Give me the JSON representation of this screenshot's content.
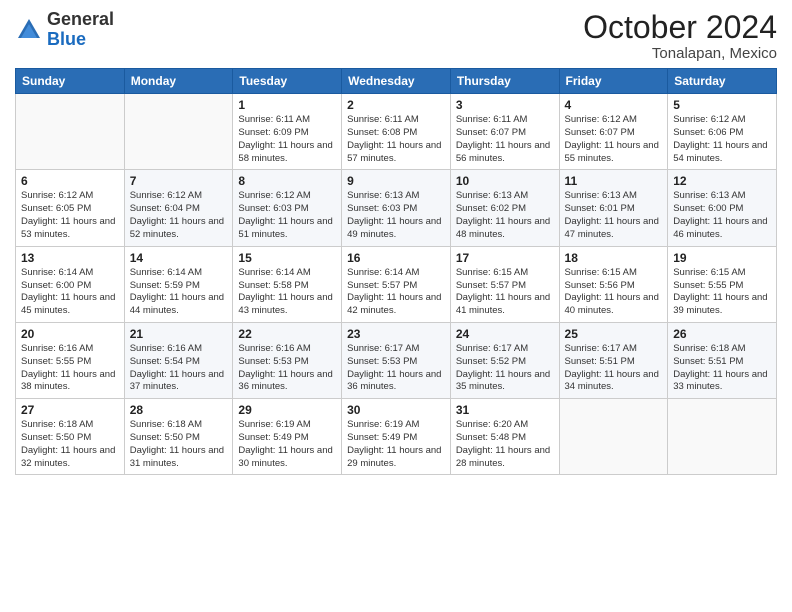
{
  "header": {
    "logo_general": "General",
    "logo_blue": "Blue",
    "month_title": "October 2024",
    "location": "Tonalapan, Mexico"
  },
  "weekdays": [
    "Sunday",
    "Monday",
    "Tuesday",
    "Wednesday",
    "Thursday",
    "Friday",
    "Saturday"
  ],
  "weeks": [
    [
      {
        "day": "",
        "info": ""
      },
      {
        "day": "",
        "info": ""
      },
      {
        "day": "1",
        "info": "Sunrise: 6:11 AM\nSunset: 6:09 PM\nDaylight: 11 hours and 58 minutes."
      },
      {
        "day": "2",
        "info": "Sunrise: 6:11 AM\nSunset: 6:08 PM\nDaylight: 11 hours and 57 minutes."
      },
      {
        "day": "3",
        "info": "Sunrise: 6:11 AM\nSunset: 6:07 PM\nDaylight: 11 hours and 56 minutes."
      },
      {
        "day": "4",
        "info": "Sunrise: 6:12 AM\nSunset: 6:07 PM\nDaylight: 11 hours and 55 minutes."
      },
      {
        "day": "5",
        "info": "Sunrise: 6:12 AM\nSunset: 6:06 PM\nDaylight: 11 hours and 54 minutes."
      }
    ],
    [
      {
        "day": "6",
        "info": "Sunrise: 6:12 AM\nSunset: 6:05 PM\nDaylight: 11 hours and 53 minutes."
      },
      {
        "day": "7",
        "info": "Sunrise: 6:12 AM\nSunset: 6:04 PM\nDaylight: 11 hours and 52 minutes."
      },
      {
        "day": "8",
        "info": "Sunrise: 6:12 AM\nSunset: 6:03 PM\nDaylight: 11 hours and 51 minutes."
      },
      {
        "day": "9",
        "info": "Sunrise: 6:13 AM\nSunset: 6:03 PM\nDaylight: 11 hours and 49 minutes."
      },
      {
        "day": "10",
        "info": "Sunrise: 6:13 AM\nSunset: 6:02 PM\nDaylight: 11 hours and 48 minutes."
      },
      {
        "day": "11",
        "info": "Sunrise: 6:13 AM\nSunset: 6:01 PM\nDaylight: 11 hours and 47 minutes."
      },
      {
        "day": "12",
        "info": "Sunrise: 6:13 AM\nSunset: 6:00 PM\nDaylight: 11 hours and 46 minutes."
      }
    ],
    [
      {
        "day": "13",
        "info": "Sunrise: 6:14 AM\nSunset: 6:00 PM\nDaylight: 11 hours and 45 minutes."
      },
      {
        "day": "14",
        "info": "Sunrise: 6:14 AM\nSunset: 5:59 PM\nDaylight: 11 hours and 44 minutes."
      },
      {
        "day": "15",
        "info": "Sunrise: 6:14 AM\nSunset: 5:58 PM\nDaylight: 11 hours and 43 minutes."
      },
      {
        "day": "16",
        "info": "Sunrise: 6:14 AM\nSunset: 5:57 PM\nDaylight: 11 hours and 42 minutes."
      },
      {
        "day": "17",
        "info": "Sunrise: 6:15 AM\nSunset: 5:57 PM\nDaylight: 11 hours and 41 minutes."
      },
      {
        "day": "18",
        "info": "Sunrise: 6:15 AM\nSunset: 5:56 PM\nDaylight: 11 hours and 40 minutes."
      },
      {
        "day": "19",
        "info": "Sunrise: 6:15 AM\nSunset: 5:55 PM\nDaylight: 11 hours and 39 minutes."
      }
    ],
    [
      {
        "day": "20",
        "info": "Sunrise: 6:16 AM\nSunset: 5:55 PM\nDaylight: 11 hours and 38 minutes."
      },
      {
        "day": "21",
        "info": "Sunrise: 6:16 AM\nSunset: 5:54 PM\nDaylight: 11 hours and 37 minutes."
      },
      {
        "day": "22",
        "info": "Sunrise: 6:16 AM\nSunset: 5:53 PM\nDaylight: 11 hours and 36 minutes."
      },
      {
        "day": "23",
        "info": "Sunrise: 6:17 AM\nSunset: 5:53 PM\nDaylight: 11 hours and 36 minutes."
      },
      {
        "day": "24",
        "info": "Sunrise: 6:17 AM\nSunset: 5:52 PM\nDaylight: 11 hours and 35 minutes."
      },
      {
        "day": "25",
        "info": "Sunrise: 6:17 AM\nSunset: 5:51 PM\nDaylight: 11 hours and 34 minutes."
      },
      {
        "day": "26",
        "info": "Sunrise: 6:18 AM\nSunset: 5:51 PM\nDaylight: 11 hours and 33 minutes."
      }
    ],
    [
      {
        "day": "27",
        "info": "Sunrise: 6:18 AM\nSunset: 5:50 PM\nDaylight: 11 hours and 32 minutes."
      },
      {
        "day": "28",
        "info": "Sunrise: 6:18 AM\nSunset: 5:50 PM\nDaylight: 11 hours and 31 minutes."
      },
      {
        "day": "29",
        "info": "Sunrise: 6:19 AM\nSunset: 5:49 PM\nDaylight: 11 hours and 30 minutes."
      },
      {
        "day": "30",
        "info": "Sunrise: 6:19 AM\nSunset: 5:49 PM\nDaylight: 11 hours and 29 minutes."
      },
      {
        "day": "31",
        "info": "Sunrise: 6:20 AM\nSunset: 5:48 PM\nDaylight: 11 hours and 28 minutes."
      },
      {
        "day": "",
        "info": ""
      },
      {
        "day": "",
        "info": ""
      }
    ]
  ]
}
